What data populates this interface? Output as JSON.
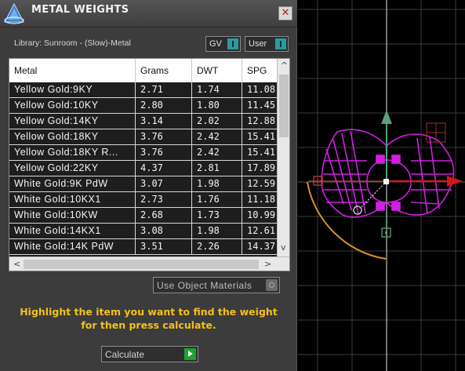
{
  "window": {
    "title": "METAL WEIGHTS",
    "close_glyph": "✕",
    "icon": "metal-weights-logo-icon"
  },
  "library": {
    "label": "Library: Sunroom - (Slow)-Metal"
  },
  "dropdowns": {
    "unit": "GV",
    "source": "User"
  },
  "table": {
    "columns": [
      "Metal",
      "Grams",
      "DWT",
      "SPG"
    ],
    "rows": [
      [
        "Yellow Gold:9KY",
        "2.71",
        "1.74",
        "11.08"
      ],
      [
        "Yellow Gold:10KY",
        "2.80",
        "1.80",
        "11.45"
      ],
      [
        "Yellow Gold:14KY",
        "3.14",
        "2.02",
        "12.88"
      ],
      [
        "Yellow Gold:18KY",
        "3.76",
        "2.42",
        "15.41"
      ],
      [
        "Yellow Gold:18KY R...",
        "3.76",
        "2.42",
        "15.41"
      ],
      [
        "Yellow Gold:22KY",
        "4.37",
        "2.81",
        "17.89"
      ],
      [
        "White Gold:9K PdW",
        "3.07",
        "1.98",
        "12.59"
      ],
      [
        "White Gold:10KX1",
        "2.73",
        "1.76",
        "11.18"
      ],
      [
        "White Gold:10KW",
        "2.68",
        "1.73",
        "10.99"
      ],
      [
        "White Gold:14KX1",
        "3.08",
        "1.98",
        "12.61"
      ],
      [
        "White Gold:14K PdW",
        "3.51",
        "2.26",
        "14.37"
      ]
    ],
    "scroll_up_glyph": "^",
    "scroll_down_glyph": "v",
    "scroll_left_glyph": "<",
    "scroll_right_glyph": ">"
  },
  "use_object_materials": {
    "label": "Use Object Materials"
  },
  "hint": {
    "line1": "Highlight the item you want to find the weight",
    "line2": "for then press calculate."
  },
  "calculate": {
    "label": "Calculate"
  },
  "colors": {
    "panel": "#3c3c3c",
    "hint_text": "#f3c11d",
    "accent_teal": "#2b9ca0",
    "calc_green": "#19a431",
    "model_magenta": "#d020e0",
    "grid": "#3a3a3a"
  }
}
